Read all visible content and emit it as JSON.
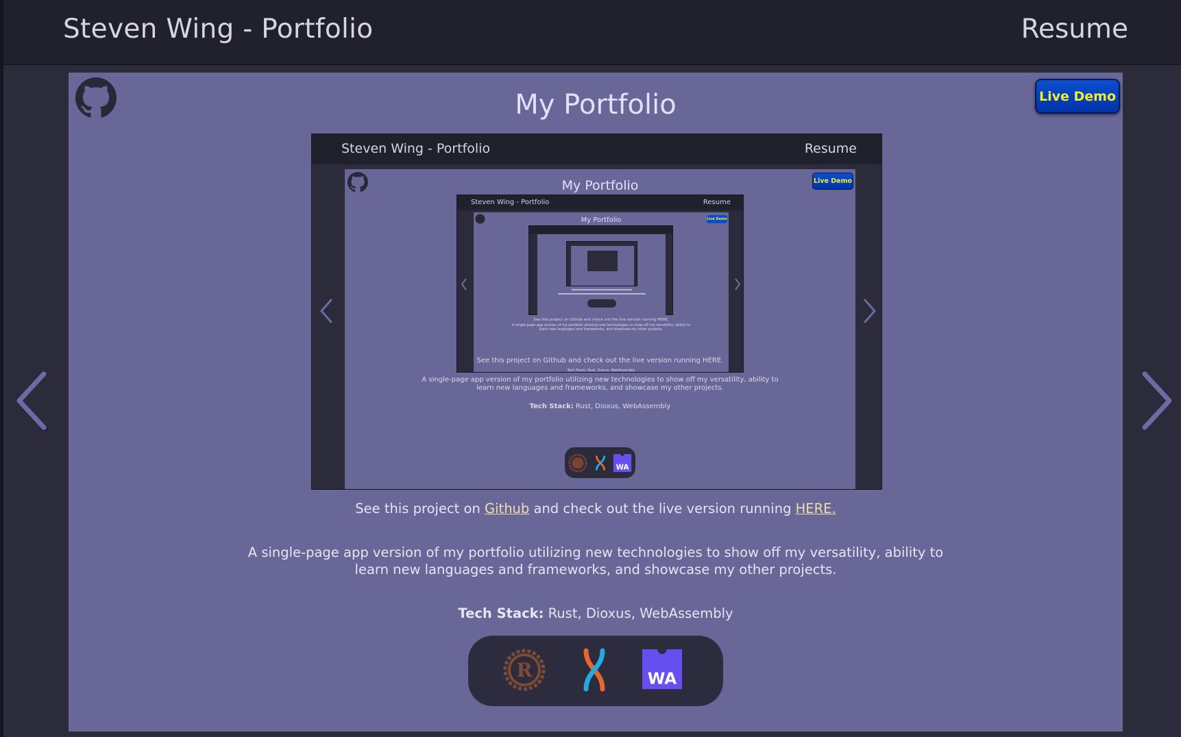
{
  "header": {
    "title": "Steven Wing - Portfolio",
    "resume_label": "Resume"
  },
  "card": {
    "title": "My Portfolio",
    "live_demo_label": "Live Demo",
    "links_sentence": {
      "part1": "See this project on ",
      "github_link": "Github",
      "part2": " and check out the live version running ",
      "here_link": "HERE."
    },
    "description": "A single-page app version of my portfolio utilizing new technologies to show off my versatility, ability to learn new languages and frameworks, and showcase my other projects.",
    "tech_stack_label": "Tech Stack:",
    "tech_stack_value": " Rust, Dioxus, WebAssembly",
    "tech_icons": [
      "rust-icon",
      "dioxus-icon",
      "webassembly-icon"
    ],
    "wa_text": "WA"
  },
  "preview": {
    "header_title": "Steven Wing - Portfolio",
    "header_resume": "Resume",
    "card_title": "My Portfolio",
    "live_demo": "Live Demo",
    "links_line": "See this project on Github and check out the live version running HERE.",
    "description": "A single-page app version of my portfolio utilizing new technologies to show off my versatility, ability to learn new languages and frameworks, and showcase my other projects.",
    "tech_label": "Tech Stack:",
    "tech_value": " Rust, Dioxus, WebAssembly",
    "nested_header_title": "Steven Wing - Portfolio",
    "nested_header_resume": "Resume",
    "nested_card_title": "My Portfolio",
    "nested_live_demo": "Live Demo",
    "nested_links_line": "See this project on Github and check out the live version running HERE.",
    "nested_description": "A single-page app version of my portfolio utilizing new technologies to show off my versatility, ability to learn new languages and frameworks, and showcase my other projects.",
    "nested_tech_line": "Tech Stack: Rust, Dioxus, WebAssembly"
  },
  "colors": {
    "background": "#2c2b3c",
    "header": "#21202d",
    "card": "#686797",
    "title": "#e2e0fb",
    "arrow": "#6c6ba4",
    "live_demo_bg": "#0a4ecf",
    "live_demo_text": "#f2ee2a",
    "link": "#f0dfae"
  }
}
